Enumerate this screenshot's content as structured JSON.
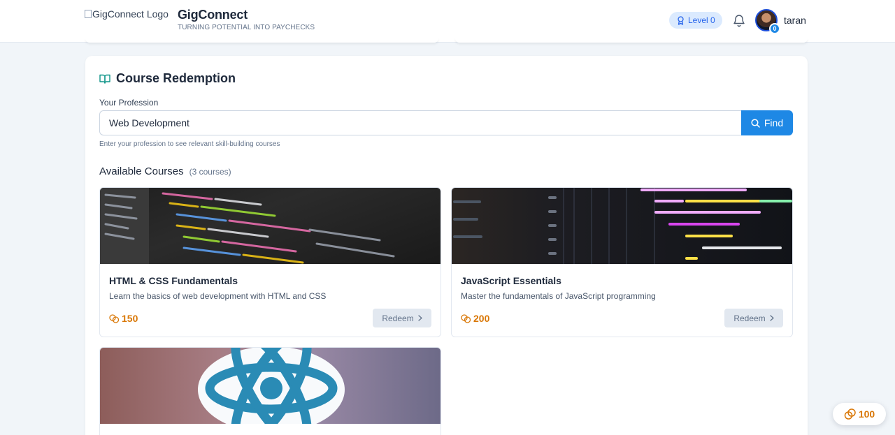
{
  "header": {
    "logo_alt": "GigConnect Logo",
    "brand_name": "GigConnect",
    "tagline": "TURNING POTENTIAL INTO PAYCHECKS",
    "level_label": "Level 0",
    "avatar_badge": "0",
    "username": "taran"
  },
  "redemption": {
    "title": "Course Redemption",
    "profession_label": "Your Profession",
    "profession_value": "Web Development",
    "find_label": "Find",
    "hint": "Enter your profession to see relevant skill-building courses",
    "available_title": "Available Courses",
    "available_count": "(3 courses)",
    "courses": [
      {
        "title": "HTML & CSS Fundamentals",
        "description": "Learn the basics of web development with HTML and CSS",
        "cost": "150",
        "redeem_label": "Redeem"
      },
      {
        "title": "JavaScript Essentials",
        "description": "Master the fundamentals of JavaScript programming",
        "cost": "200",
        "redeem_label": "Redeem"
      }
    ]
  },
  "points_fab": "100",
  "colors": {
    "accent": "#1e88e5",
    "coin": "#d97706",
    "page_bg": "#f1f5f9"
  }
}
